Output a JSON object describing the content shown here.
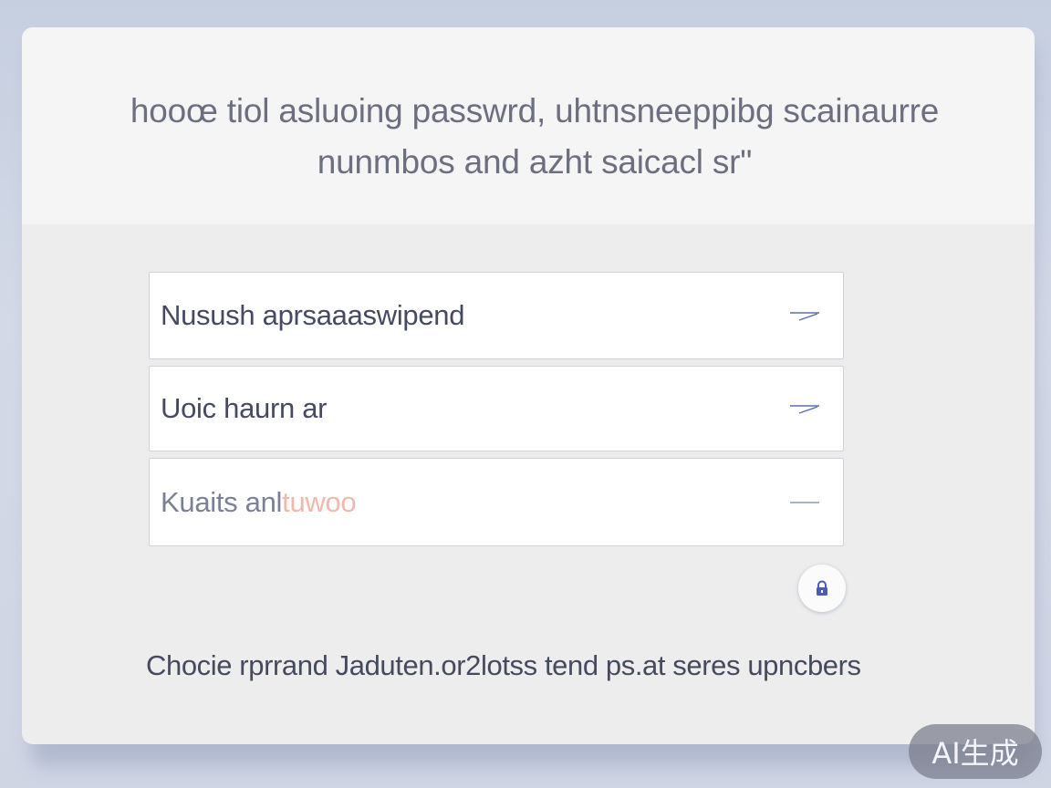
{
  "header": {
    "line1": "hooœ tiol asluoing passwrd, uhtnsneeppibg scainaurre",
    "line2": "nunmbos and azht saicacl sr\""
  },
  "fields": [
    {
      "text": "Nusush aprsaaaswipend",
      "icon": "arrow-right-icon"
    },
    {
      "text": "Uoic haurn ar",
      "icon": "arrow-right-icon"
    },
    {
      "text_main": "Kuaits anl",
      "text_faded": "tuwoo",
      "icon": "dash-icon"
    }
  ],
  "lock_button": {
    "icon": "lock-icon"
  },
  "footer": {
    "text": "Chocie rprrand Jaduten.or2lotss tend ps.at seres upncbers"
  },
  "badge": {
    "text": "AI生成"
  },
  "colors": {
    "accent": "#5b6fb0",
    "header_text": "#6c6f80",
    "field_text": "#454a62",
    "faded_text": "#f0b8ad"
  }
}
